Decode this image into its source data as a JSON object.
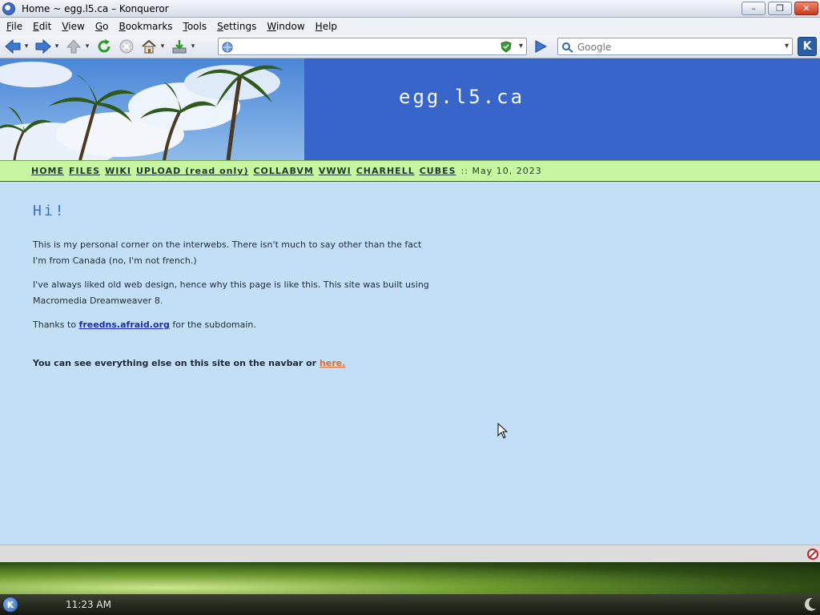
{
  "window": {
    "title": "Home ~ egg.l5.ca – Konqueror",
    "minimize_glyph": "–",
    "maximize_glyph": "❐",
    "close_glyph": "✕"
  },
  "menubar": [
    {
      "label": "File",
      "mnemonic": "F"
    },
    {
      "label": "Edit",
      "mnemonic": "E"
    },
    {
      "label": "View",
      "mnemonic": "V"
    },
    {
      "label": "Go",
      "mnemonic": "G"
    },
    {
      "label": "Bookmarks",
      "mnemonic": "B"
    },
    {
      "label": "Tools",
      "mnemonic": "T"
    },
    {
      "label": "Settings",
      "mnemonic": "S"
    },
    {
      "label": "Window",
      "mnemonic": "W"
    },
    {
      "label": "Help",
      "mnemonic": "H"
    }
  ],
  "toolbar": {
    "buttons": [
      "back-icon",
      "forward-icon",
      "up-icon",
      "reload-icon",
      "stop-icon",
      "home-icon",
      "download-icon"
    ],
    "url_value": "",
    "search_placeholder": "Google",
    "kde_logo": "K"
  },
  "page": {
    "site_title": "egg.l5.ca",
    "nav_links": [
      "HOME",
      "FILES",
      "WIKI",
      "UPLOAD (read only)",
      "COLLABVM",
      "VWWI",
      "CHARHELL",
      "CUBES"
    ],
    "nav_separator": "::",
    "date": "May 10, 2023",
    "heading": "Hi!",
    "para1": "This is my personal corner on the interwebs. There isn't much to say other than the fact I'm from Canada (no, I'm not french.)",
    "para2": "I've always liked old web design, hence why this page is like this. This site was built using Macromedia Dreamweaver 8.",
    "para3_before": "Thanks to ",
    "para3_link": "freedns.afraid.org",
    "para3_after": " for the subdomain.",
    "para4_before": "You can see everything else on this site on the navbar or ",
    "para4_link": "here."
  },
  "colors": {
    "banner": "#3765c9",
    "navbar": "#c6f7a0",
    "page_bg": "#c3dff7",
    "heading": "#3b6fc6",
    "link_blue": "#1c2eb0",
    "link_orange": "#e36b2b"
  },
  "taskbar": {
    "kmenu": "K",
    "clock": "11:23 AM"
  }
}
